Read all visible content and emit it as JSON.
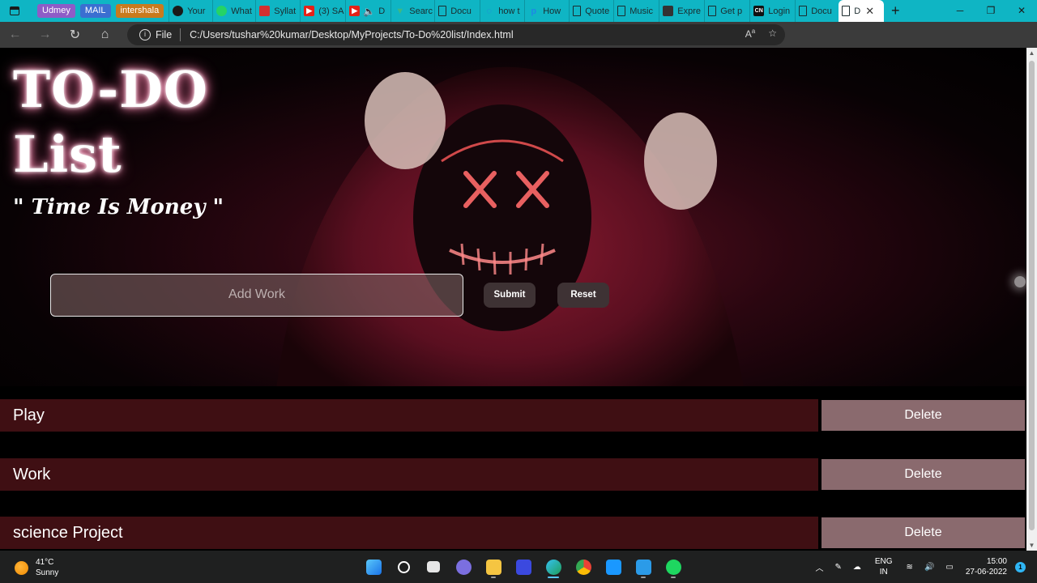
{
  "browser": {
    "tabs_pinned": [
      {
        "label": "Udmey",
        "color": "#8e5cc7"
      },
      {
        "label": "MAIL",
        "color": "#3a6fd1"
      },
      {
        "label": "intershala",
        "color": "#c97a1d"
      }
    ],
    "tabs": [
      {
        "label": "Your",
        "icon": "github-icon",
        "color": "#1a1a1a"
      },
      {
        "label": "What",
        "icon": "whatsapp-icon",
        "color": "#25d366"
      },
      {
        "label": "Syllat",
        "icon": "pdf-icon",
        "color": "#d32f2f"
      },
      {
        "label": "(3) SA",
        "icon": "youtube-icon",
        "color": "#e62117"
      },
      {
        "label": "D",
        "icon": "youtube-icon",
        "color": "#e62117"
      },
      {
        "label": "Searc",
        "icon": "vue-icon",
        "color": "#3fb883"
      },
      {
        "label": "Docu",
        "icon": "page-icon",
        "color": "#ffffff"
      },
      {
        "label": "how t",
        "icon": "search-icon",
        "color": "#2a7de1"
      },
      {
        "label": "How",
        "icon": "p-icon",
        "color": "#1e88e5"
      },
      {
        "label": "Quote",
        "icon": "page-icon",
        "color": "#ffffff"
      },
      {
        "label": "Music",
        "icon": "page-icon",
        "color": "#ffffff"
      },
      {
        "label": "Expre",
        "icon": "film-icon",
        "color": "#333333"
      },
      {
        "label": "Get p",
        "icon": "page-icon",
        "color": "#ffffff"
      },
      {
        "label": "Login",
        "icon": "cn-icon",
        "color": "#111111"
      },
      {
        "label": "Docu",
        "icon": "page-icon",
        "color": "#ffffff"
      }
    ],
    "active_tab": {
      "label": "D"
    },
    "url_scheme": "File",
    "url": "C:/Users/tushar%20kumar/Desktop/MyProjects/To-Do%20list/Index.html"
  },
  "page": {
    "title_line1": "TO-DO",
    "title_line2": "List",
    "quote": "\" Time Is Money \"",
    "input_placeholder": "Add Work",
    "submit_label": "Submit",
    "reset_label": "Reset",
    "items": [
      {
        "text": "Play",
        "delete_label": "Delete"
      },
      {
        "text": "Work",
        "delete_label": "Delete"
      },
      {
        "text": "science Project",
        "delete_label": "Delete"
      }
    ],
    "colors": {
      "row_background": "#3f0f13",
      "delete_background": "#8a6a6e",
      "button_background": "#3e3234"
    }
  },
  "taskbar": {
    "temperature": "41°C",
    "weather": "Sunny",
    "lang_line1": "ENG",
    "lang_line2": "IN",
    "time": "15:00",
    "date": "27-06-2022"
  }
}
